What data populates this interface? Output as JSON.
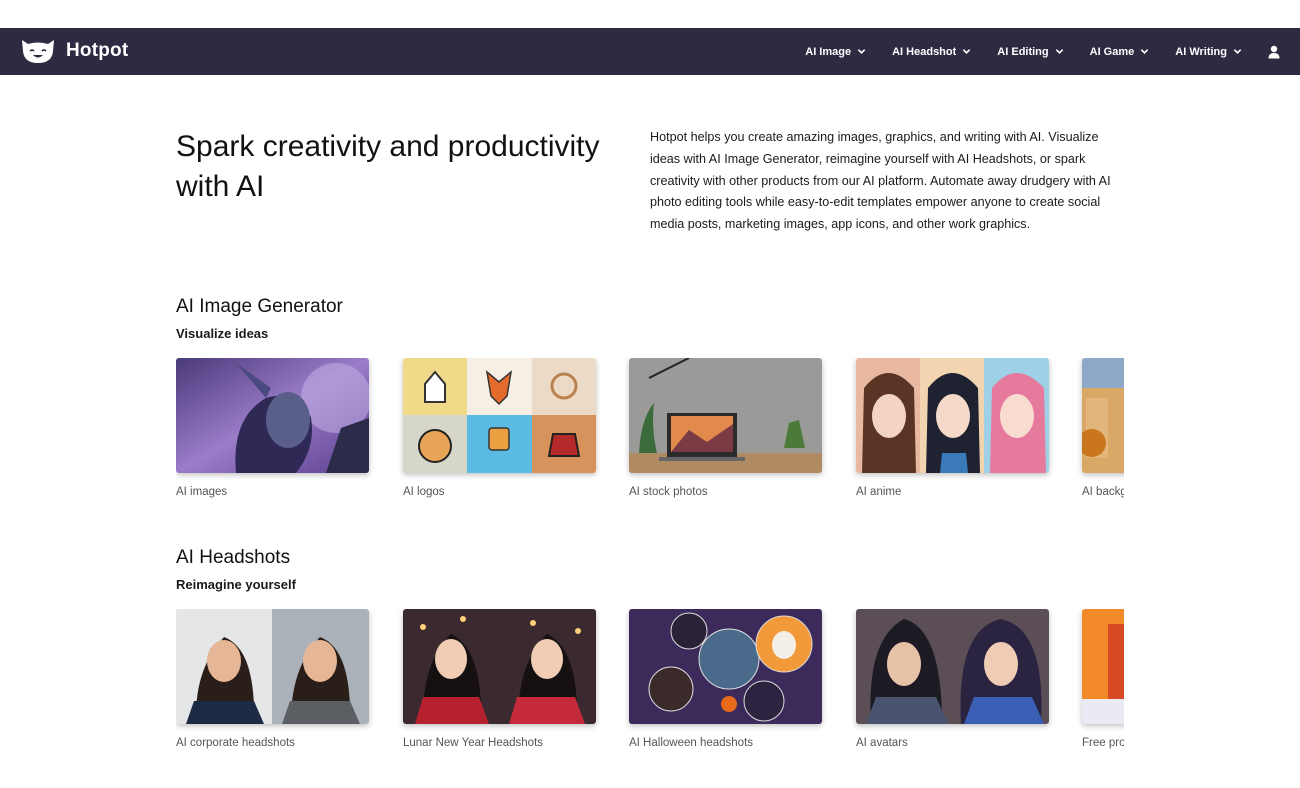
{
  "header": {
    "brand": "Hotpot",
    "menu": [
      {
        "label": "AI Image"
      },
      {
        "label": "AI Headshot"
      },
      {
        "label": "AI Editing"
      },
      {
        "label": "AI Game"
      },
      {
        "label": "AI Writing"
      }
    ],
    "colors": {
      "bar": "#302942",
      "text": "#ffffff"
    }
  },
  "hero": {
    "title": "Spark creativity and productivity with AI",
    "description": "Hotpot helps you create amazing images, graphics, and writing with AI. Visualize ideas with AI Image Generator, reimagine yourself with AI Headshots, or spark creativity with other products from our AI platform. Automate away drudgery with AI photo editing tools while easy-to-edit templates empower anyone to create social media posts, marketing images, app icons, and other work graphics."
  },
  "sections": [
    {
      "title": "AI Image Generator",
      "subtitle": "Visualize ideas",
      "cards": [
        {
          "label": "AI images"
        },
        {
          "label": "AI logos"
        },
        {
          "label": "AI stock photos"
        },
        {
          "label": "AI anime"
        },
        {
          "label": "AI backgrounds"
        }
      ]
    },
    {
      "title": "AI Headshots",
      "subtitle": "Reimagine yourself",
      "cards": [
        {
          "label": "AI corporate headshots"
        },
        {
          "label": "Lunar New Year Headshots"
        },
        {
          "label": "AI Halloween headshots"
        },
        {
          "label": "AI avatars"
        },
        {
          "label": "Free profile pictures"
        }
      ]
    }
  ]
}
